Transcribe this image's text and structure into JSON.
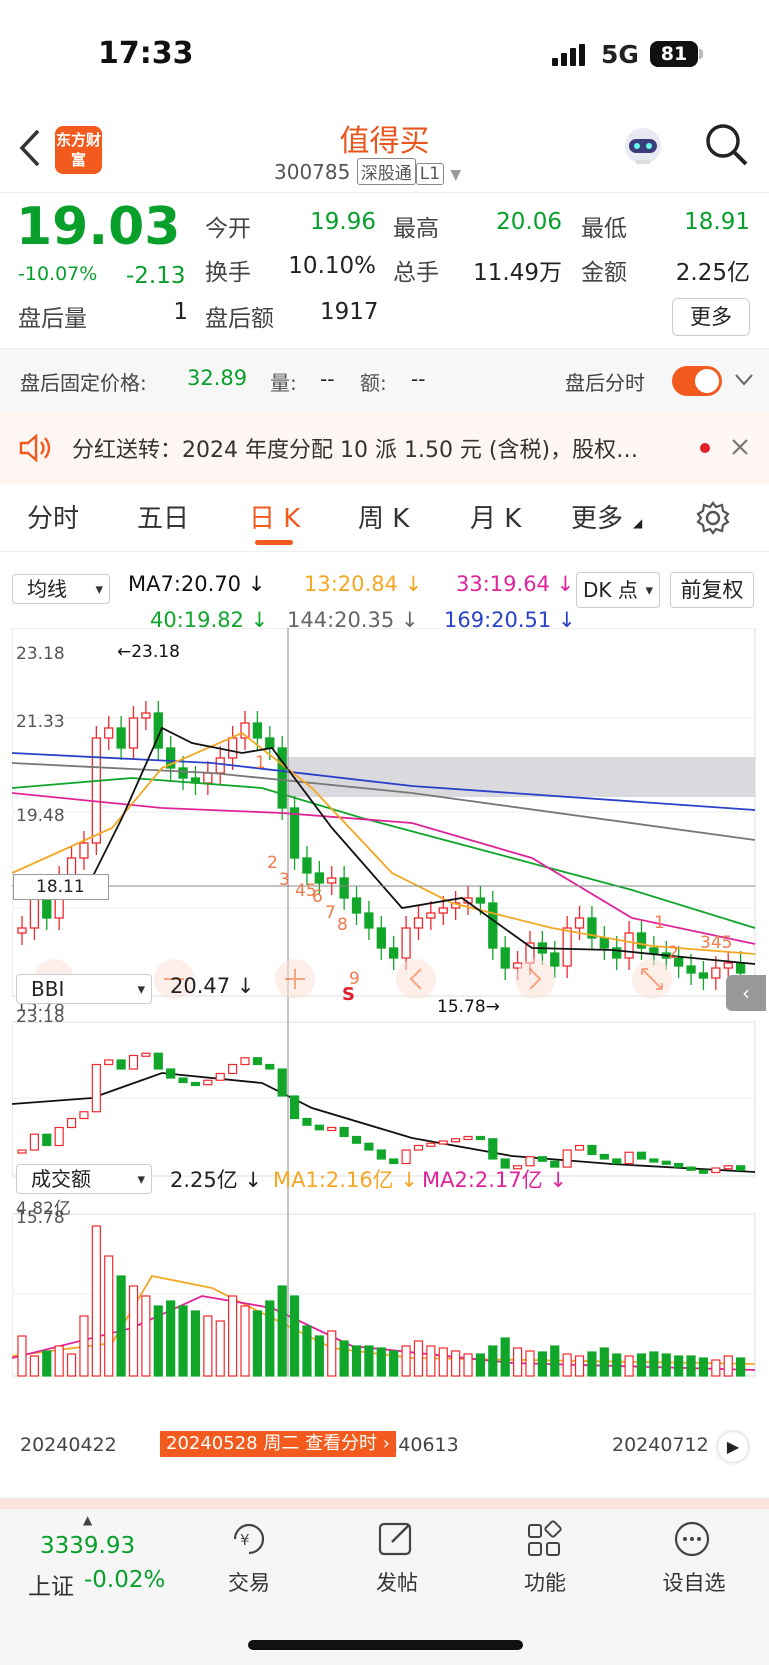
{
  "status_bar": {
    "time": "17:33",
    "network": "5G",
    "battery": "81"
  },
  "nav": {
    "logo_text": "东方财富",
    "title": "值得买",
    "code": "300785",
    "tag1": "深股通",
    "tag2": "L1"
  },
  "quote": {
    "price": "19.03",
    "pct": "-10.07%",
    "change": "-2.13",
    "open_label": "今开",
    "open": "19.96",
    "high_label": "最高",
    "high": "20.06",
    "low_label": "最低",
    "low": "18.91",
    "turnover_label": "换手",
    "turnover": "10.10%",
    "volume_label": "总手",
    "volume": "11.49万",
    "amount_label": "金额",
    "amount": "2.25亿",
    "ah_vol_label": "盘后量",
    "ah_vol": "1",
    "ah_amt_label": "盘后额",
    "ah_amt": "1917",
    "more": "更多"
  },
  "afterhours": {
    "label": "盘后固定价格:",
    "price": "32.89",
    "vol_label": "量:",
    "vol": "--",
    "amt_label": "额:",
    "amt": "--",
    "switch_label": "盘后分时"
  },
  "notice": {
    "text": "分红送转：2024 年度分配 10 派 1.50 元 (含税)，股权…"
  },
  "tabs": [
    "分时",
    "五日",
    "日 K",
    "周 K",
    "月 K",
    "更多"
  ],
  "ma_legend": {
    "selector": "均线",
    "ma7": "MA7:20.70 ↓",
    "ma13": "13:20.84 ↓",
    "ma33": "33:19.64 ↓",
    "ma40": "40:19.82 ↓",
    "ma144": "144:20.35 ↓",
    "ma169": "169:20.51 ↓",
    "dk": "DK 点",
    "adj": "前复权"
  },
  "main_chart": {
    "y_top": "23.18",
    "y_mid1": "21.33",
    "y_mid2": "19.48",
    "y_bottom": "15.78",
    "crosshair_price": "18.11",
    "max_label": "←23.18",
    "min_label": "15.78→",
    "markers": [
      "1",
      "2",
      "3",
      "45",
      "6",
      "7",
      "8",
      "9",
      "1",
      "2",
      "345"
    ],
    "sell_mark": "S"
  },
  "bbi": {
    "selector": "BBI",
    "value": "20.47 ↓",
    "y_top": "23.18",
    "y_bottom": "15.78"
  },
  "volume_panel": {
    "selector": "成交额",
    "value": "2.25亿 ↓",
    "ma1": "MA1:2.16亿 ↓",
    "ma2": "MA2:2.17亿 ↓",
    "y_top": "4.82亿",
    "dates": [
      "20240422",
      "20240613",
      "20240712"
    ],
    "crosshair_date": "20240528 周二 查看分时"
  },
  "colors": {
    "up": "#f0282d",
    "down": "#11a62a",
    "ma7": "#111111",
    "ma13": "#f5a623",
    "ma33": "#e0239a",
    "ma40": "#11a62a",
    "ma144": "#777777",
    "ma169": "#2a41c9",
    "accent": "#f35a1e"
  },
  "bottom_bar": {
    "index_value": "3339.93",
    "index_name": "上证",
    "index_change": "-0.02%",
    "items": [
      "交易",
      "发帖",
      "功能",
      "设自选"
    ]
  }
}
